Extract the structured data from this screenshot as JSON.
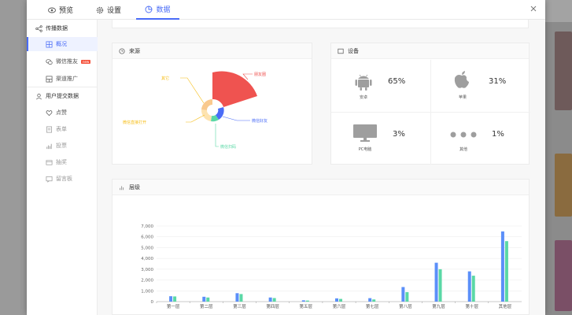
{
  "tabs": [
    {
      "label": "预览",
      "icon": "eye-icon"
    },
    {
      "label": "设置",
      "icon": "gear-icon"
    },
    {
      "label": "数据",
      "icon": "chart-pie-icon",
      "active": true
    }
  ],
  "sidebar": {
    "group1": "传播数据",
    "items1": [
      {
        "label": "概况",
        "icon": "grid-icon",
        "active": true
      },
      {
        "label": "微信推友",
        "icon": "wechat-icon",
        "badge": "new"
      },
      {
        "label": "渠道推广",
        "icon": "channel-icon"
      }
    ],
    "group2": "用户提交数据",
    "items2": [
      {
        "label": "点赞",
        "icon": "heart-icon"
      },
      {
        "label": "表单",
        "icon": "form-icon"
      },
      {
        "label": "投票",
        "icon": "bars-icon"
      },
      {
        "label": "抽奖",
        "icon": "lottery-icon"
      },
      {
        "label": "留言板",
        "icon": "message-icon"
      }
    ]
  },
  "source_panel": {
    "title": "来源",
    "labels": [
      "朋友圈",
      "微信好友",
      "微信扫码",
      "微信直接打开",
      "其它"
    ]
  },
  "device_panel": {
    "title": "设备",
    "devices": [
      {
        "name": "安卓",
        "pct": "65%",
        "icon": "android-icon"
      },
      {
        "name": "苹果",
        "pct": "31%",
        "icon": "apple-icon"
      },
      {
        "name": "PC电脑",
        "pct": "3%",
        "icon": "monitor-icon"
      },
      {
        "name": "其他",
        "pct": "1%",
        "icon": "more-dots-icon"
      }
    ]
  },
  "level_panel": {
    "title": "层级"
  },
  "colors": {
    "accent": "#4a6cf7",
    "red": "#ef5350",
    "blue": "#5b8ff9",
    "green": "#5ad8a6",
    "orange": "#f6bd16"
  },
  "chart_data": {
    "type": "bar",
    "categories": [
      "第一层",
      "第二层",
      "第三层",
      "第四层",
      "第五层",
      "第六层",
      "第七层",
      "第八层",
      "第九层",
      "第十层",
      "其他层"
    ],
    "series": [
      {
        "values": [
          500,
          450,
          780,
          380,
          120,
          300,
          320,
          1350,
          3600,
          2800,
          6500
        ]
      },
      {
        "values": [
          480,
          380,
          700,
          330,
          100,
          250,
          200,
          880,
          3000,
          2400,
          5600
        ]
      }
    ],
    "yticks": [
      "0",
      "1,000",
      "2,000",
      "3,000",
      "4,000",
      "5,000",
      "6,000",
      "7,000"
    ],
    "ylim": [
      0,
      7000
    ]
  }
}
